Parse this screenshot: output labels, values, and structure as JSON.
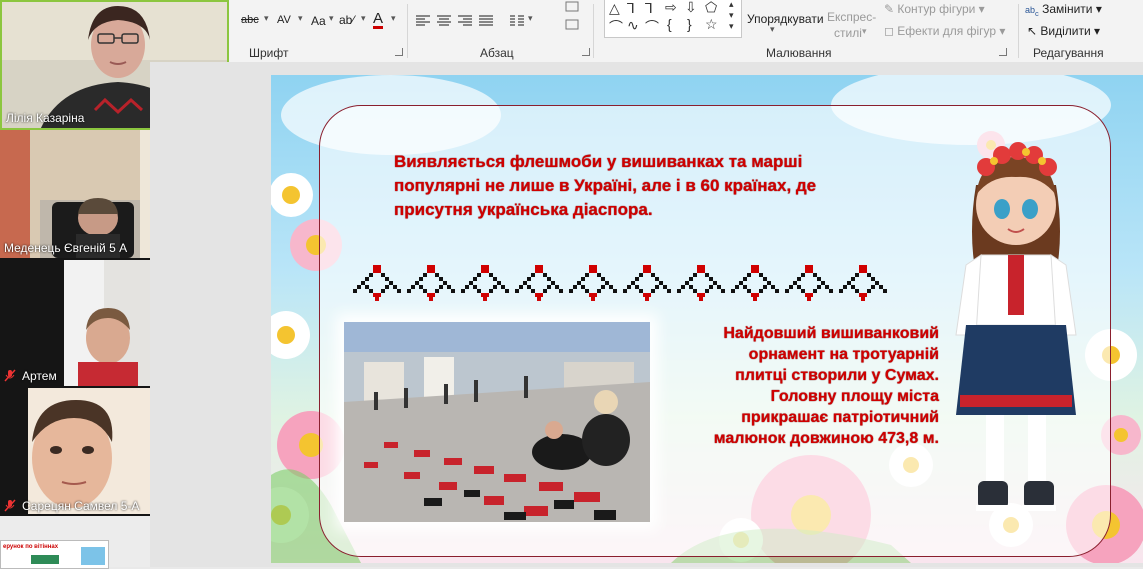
{
  "ribbon": {
    "font_group_label": "Шрифт",
    "paragraph_group_label": "Абзац",
    "drawing_group_label": "Малювання",
    "editing_group_label": "Редагування",
    "arrange_label": "Упорядкувати",
    "quick_styles_label_1": "Експрес-",
    "quick_styles_label_2": "стилі",
    "shape_outline_label": "Контур фігури",
    "shape_effects_label": "Ефекти для фігур",
    "replace_label": "Замінити",
    "select_label": "Виділити",
    "font_case_glyph": "Aa",
    "font_color_glyph": "A",
    "strikethrough_glyph": "abc",
    "spacing_glyph": "AV"
  },
  "participants": [
    {
      "name": "Лілія Казаріна",
      "muted": false
    },
    {
      "name": "Меденець Євгеній 5 А",
      "muted": false
    },
    {
      "name": "Артем",
      "muted": true
    },
    {
      "name": "Сарецян Самвел 5-А",
      "muted": true
    }
  ],
  "thumbnail": {
    "caption": "ерунок по вітіннах"
  },
  "slide": {
    "text_top": "Виявляється флешмоби у вишиванках та марші популярні не лише в Україні, але і в 60 країнах, де присутня українська діаспора.",
    "text_right_lines": [
      "Найдовший вишиванковий",
      "орнамент на тротуарній",
      "плитці створили у Сумах.",
      "Головну площу міста",
      "прикрашає патріотичний",
      "малюнок довжиною 473,8 м."
    ]
  },
  "colors": {
    "accent_red": "#d00000",
    "frame": "#8a1f2e",
    "ribbon_bg": "#f3f3f3",
    "active_speaker_border": "#8cc63f"
  }
}
